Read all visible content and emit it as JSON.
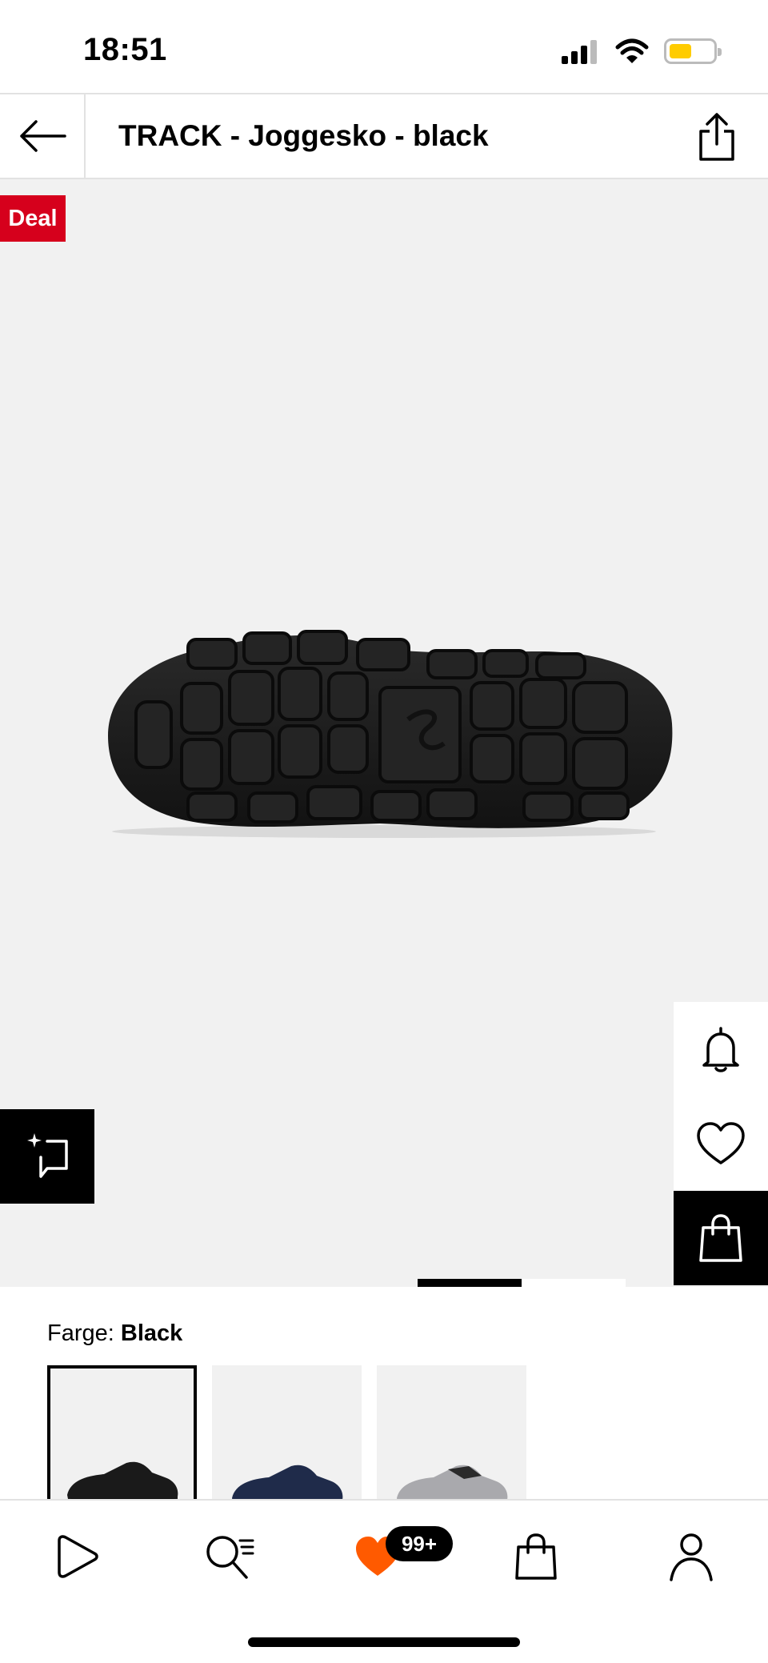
{
  "status_bar": {
    "time": "18:51"
  },
  "header": {
    "title": "TRACK - Joggesko - black"
  },
  "gallery": {
    "deal_badge": "Deal",
    "page_count": 2,
    "active_page": 1
  },
  "color_picker": {
    "label": "Farge:",
    "selected_value": "Black",
    "options": [
      "Black",
      "Navy",
      "Grey"
    ]
  },
  "bottom_nav": {
    "wishlist_badge": "99+"
  },
  "colors": {
    "deal": "#d6001c",
    "accent_orange": "#ff5a00",
    "battery": "#ffcc00",
    "background_gallery": "#f1f1f1"
  },
  "icons": {
    "back": "arrow-left-icon",
    "share": "share-icon",
    "notify": "bell-icon",
    "wishlist": "heart-icon",
    "add_to_bag": "bag-icon",
    "try_on": "sparkle-frame-icon",
    "nav": [
      "play-icon",
      "search-list-icon",
      "heart-icon",
      "bag-icon",
      "user-icon"
    ]
  }
}
